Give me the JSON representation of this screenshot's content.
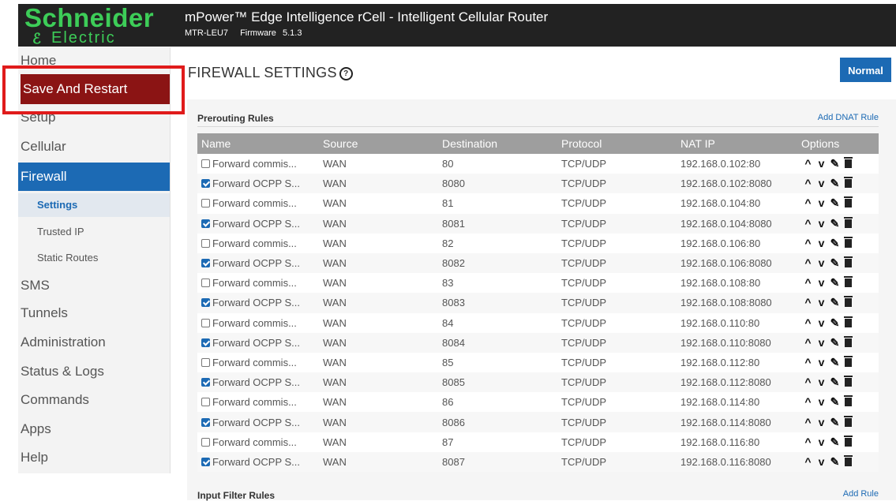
{
  "header": {
    "logo_top": "Schneider",
    "logo_bottom": "Electric",
    "title": "mPower™ Edge Intelligence rCell - Intelligent Cellular Router",
    "model": "MTR-LEU7",
    "firmware_label": "Firmware",
    "firmware_version": "5.1.3"
  },
  "sidebar": {
    "home": "Home",
    "save_restart": "Save And Restart",
    "setup": "Setup",
    "cellular": "Cellular",
    "firewall": "Firewall",
    "settings": "Settings",
    "trusted_ip": "Trusted IP",
    "static_routes": "Static Routes",
    "sms": "SMS",
    "tunnels": "Tunnels",
    "administration": "Administration",
    "status_logs": "Status & Logs",
    "commands": "Commands",
    "apps": "Apps",
    "help": "Help"
  },
  "page": {
    "title": "FIREWALL SETTINGS",
    "mode_button": "Normal"
  },
  "prerouting": {
    "title": "Prerouting Rules",
    "add_link": "Add DNAT Rule",
    "columns": [
      "Name",
      "Source",
      "Destination",
      "Protocol",
      "NAT IP",
      "Options"
    ],
    "rows": [
      {
        "checked": false,
        "name": "Forward commis...",
        "source": "WAN",
        "destination": "80",
        "protocol": "TCP/UDP",
        "nat_ip": "192.168.0.102:80"
      },
      {
        "checked": true,
        "name": "Forward OCPP S...",
        "source": "WAN",
        "destination": "8080",
        "protocol": "TCP/UDP",
        "nat_ip": "192.168.0.102:8080"
      },
      {
        "checked": false,
        "name": "Forward commis...",
        "source": "WAN",
        "destination": "81",
        "protocol": "TCP/UDP",
        "nat_ip": "192.168.0.104:80"
      },
      {
        "checked": true,
        "name": "Forward OCPP S...",
        "source": "WAN",
        "destination": "8081",
        "protocol": "TCP/UDP",
        "nat_ip": "192.168.0.104:8080"
      },
      {
        "checked": false,
        "name": "Forward commis...",
        "source": "WAN",
        "destination": "82",
        "protocol": "TCP/UDP",
        "nat_ip": "192.168.0.106:80"
      },
      {
        "checked": true,
        "name": "Forward OCPP S...",
        "source": "WAN",
        "destination": "8082",
        "protocol": "TCP/UDP",
        "nat_ip": "192.168.0.106:8080"
      },
      {
        "checked": false,
        "name": "Forward commis...",
        "source": "WAN",
        "destination": "83",
        "protocol": "TCP/UDP",
        "nat_ip": "192.168.0.108:80"
      },
      {
        "checked": true,
        "name": "Forward OCPP S...",
        "source": "WAN",
        "destination": "8083",
        "protocol": "TCP/UDP",
        "nat_ip": "192.168.0.108:8080"
      },
      {
        "checked": false,
        "name": "Forward commis...",
        "source": "WAN",
        "destination": "84",
        "protocol": "TCP/UDP",
        "nat_ip": "192.168.0.110:80"
      },
      {
        "checked": true,
        "name": "Forward OCPP S...",
        "source": "WAN",
        "destination": "8084",
        "protocol": "TCP/UDP",
        "nat_ip": "192.168.0.110:8080"
      },
      {
        "checked": false,
        "name": "Forward commis...",
        "source": "WAN",
        "destination": "85",
        "protocol": "TCP/UDP",
        "nat_ip": "192.168.0.112:80"
      },
      {
        "checked": true,
        "name": "Forward OCPP S...",
        "source": "WAN",
        "destination": "8085",
        "protocol": "TCP/UDP",
        "nat_ip": "192.168.0.112:8080"
      },
      {
        "checked": false,
        "name": "Forward commis...",
        "source": "WAN",
        "destination": "86",
        "protocol": "TCP/UDP",
        "nat_ip": "192.168.0.114:80"
      },
      {
        "checked": true,
        "name": "Forward OCPP S...",
        "source": "WAN",
        "destination": "8086",
        "protocol": "TCP/UDP",
        "nat_ip": "192.168.0.114:8080"
      },
      {
        "checked": false,
        "name": "Forward commis...",
        "source": "WAN",
        "destination": "87",
        "protocol": "TCP/UDP",
        "nat_ip": "192.168.0.116:80"
      },
      {
        "checked": true,
        "name": "Forward OCPP S...",
        "source": "WAN",
        "destination": "8087",
        "protocol": "TCP/UDP",
        "nat_ip": "192.168.0.116:8080"
      }
    ]
  },
  "input_filter": {
    "title": "Input Filter Rules",
    "add_link": "Add Rule"
  },
  "icons": {
    "move_up": "^",
    "move_down": "v",
    "edit": "✎",
    "delete": "trash-icon",
    "help": "?"
  },
  "colors": {
    "brand_green": "#3dcd58",
    "accent_blue": "#1c6ab4",
    "save_red": "#8b1414",
    "highlight_red": "#e01b1b"
  }
}
